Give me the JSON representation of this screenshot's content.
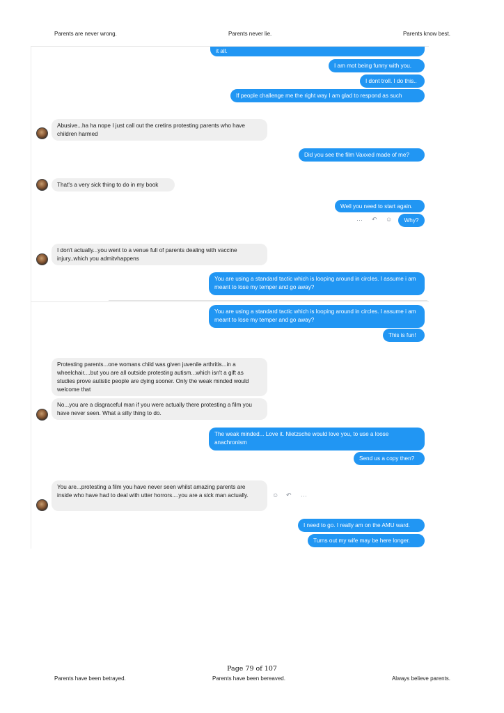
{
  "header": {
    "left": "Parents are never wrong.",
    "center": "Parents never lie.",
    "right": "Parents know best."
  },
  "footer": {
    "page": "Page 79 of 107",
    "left": "Parents have been betrayed.",
    "center": "Parents have been bereaved.",
    "right": "Always believe parents."
  },
  "messages": {
    "m1": "it all.",
    "m2": "I am mot being funny with you.",
    "m3": "I dont troll. I do this..",
    "m4": "If people challenge me the right way  I am glad to respond as such",
    "m5": "Abusive...ha ha nope I just call out the cretins protesting parents who have children harmed",
    "m6": "Did you see the film Vaxxed made of me?",
    "m7": "That's a very sick thing to do in my book",
    "m8": "Well you need to start again.",
    "m9": "Why?",
    "m10": "I don't actually...you went to a venue full of parents dealing with vaccine injury..which you admitvhappens",
    "m11": "You are using a standard tactic which is looping around in circles. I assume i am meant to lose my temper and go away?",
    "m12": "You are using a standard tactic which is looping around in circles. I assume i am meant to lose my temper and go away?",
    "m13": "This is fun!",
    "m14": "Protesting parents...one womans child was given juvenile arthritis...in a wheelchair....but you are all outside protesting autism...which isn't a gift as studies prove autistic people are dying sooner. Only the weak minded would welcome that",
    "m15": "No...you are a disgraceful man if you were actually there protesting a film you have never seen. What a silly thing to do.",
    "m16": "The weak minded... Love it. Nietzsche would love you, to use a loose anachronism",
    "m17": "Send us a copy then?",
    "m18": "You are...protesting a film you have never seen whilst amazing parents are inside who have had to deal with utter horrors....you are a sick man actually.",
    "m19": "I need to go. I really am on the AMU ward.",
    "m20": "Turns out my wife may be here longer."
  },
  "toolbar_icons": {
    "more": "···",
    "reply": "↶",
    "react": "☺"
  },
  "colors": {
    "outgoing_bubble": "#2196f3",
    "incoming_bubble": "#efefef"
  }
}
